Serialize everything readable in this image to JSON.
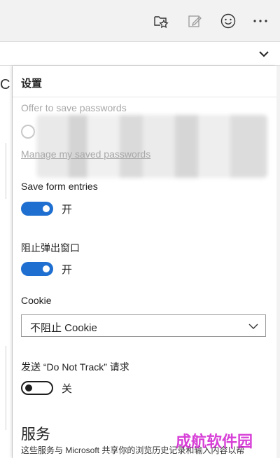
{
  "toolbar": {
    "icons": [
      "favorites-star-icon",
      "web-note-icon",
      "feedback-smiley-icon",
      "more-dots-icon"
    ]
  },
  "page_fragment": "C",
  "settings": {
    "title": "设置",
    "offer_passwords_label": "Offer to save passwords",
    "manage_passwords_link": "Manage my saved passwords",
    "save_form_entries_label": "Save form entries",
    "save_form_entries_state": "开",
    "popup_block_label": "阻止弹出窗口",
    "popup_block_state": "开",
    "cookie_label": "Cookie",
    "cookie_selected": "不阻止 Cookie",
    "dnt_label": "发送 “Do Not Track” 请求",
    "dnt_state": "关",
    "services_heading": "服务",
    "services_desc": "这些服务与 Microsoft 共享你的浏览历史记录和输入内容以帮"
  },
  "watermark": "成航软件园",
  "colors": {
    "accent": "#1f6fd1",
    "watermark": "#d01fd0"
  }
}
